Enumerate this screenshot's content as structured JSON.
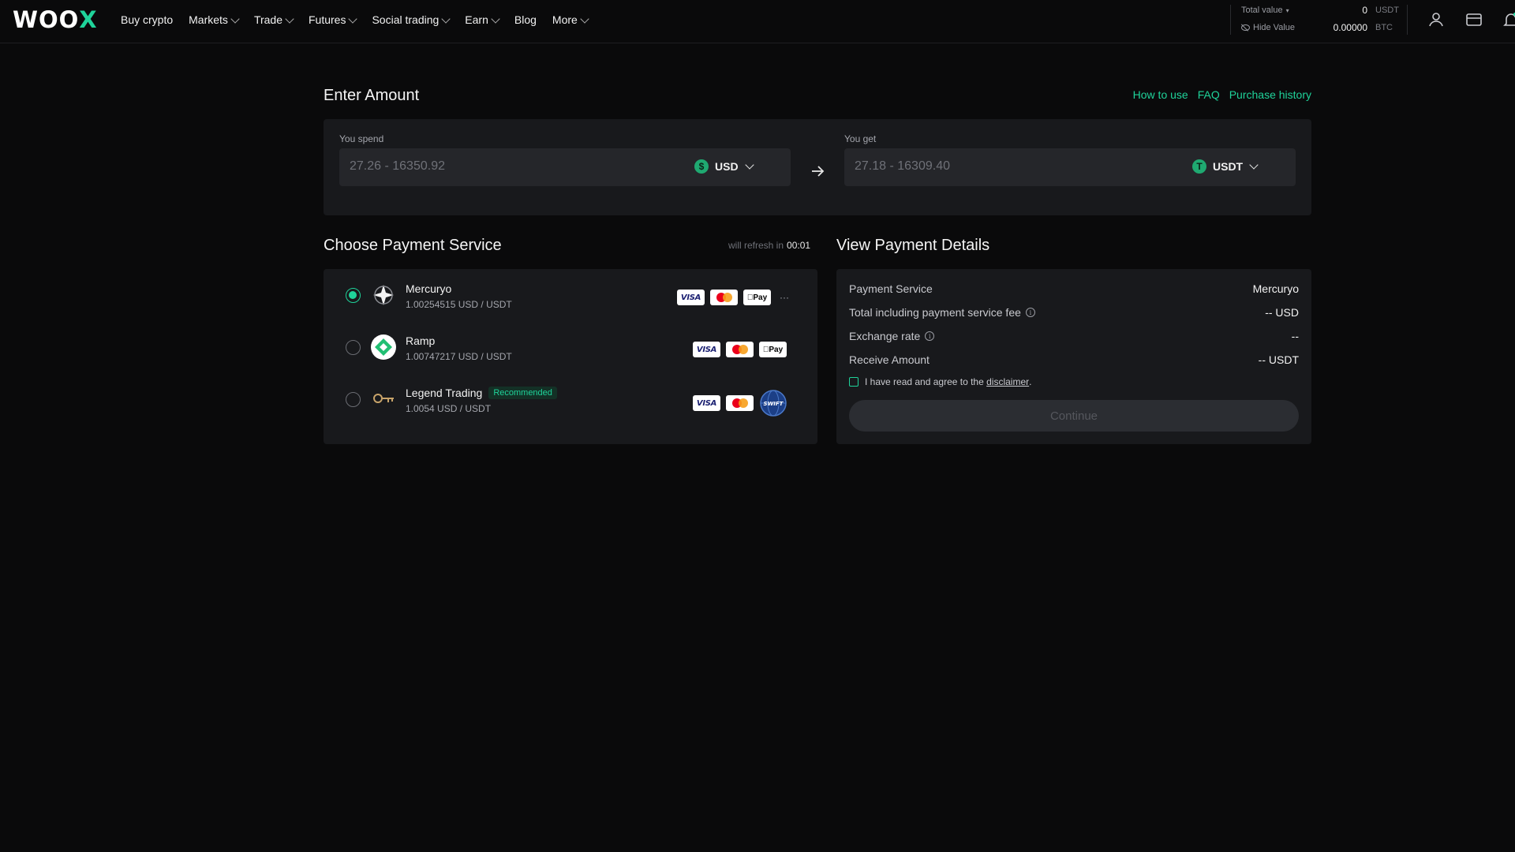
{
  "header": {
    "logo_text": "WOO",
    "logo_accent": "X",
    "nav": [
      {
        "label": "Buy crypto",
        "dropdown": false
      },
      {
        "label": "Markets",
        "dropdown": true
      },
      {
        "label": "Trade",
        "dropdown": true
      },
      {
        "label": "Futures",
        "dropdown": true
      },
      {
        "label": "Social trading",
        "dropdown": true
      },
      {
        "label": "Earn",
        "dropdown": true
      },
      {
        "label": "Blog",
        "dropdown": false
      },
      {
        "label": "More",
        "dropdown": true
      }
    ],
    "balance": {
      "total_label": "Total value",
      "total_value": "0",
      "total_unit": "USDT",
      "hide_label": "Hide Value",
      "btc_value": "0.00000",
      "btc_unit": "BTC"
    },
    "icons": [
      "user-icon",
      "wallet-icon",
      "bell-icon"
    ]
  },
  "page": {
    "title": "Enter Amount",
    "links": {
      "how_to_use": "How to use",
      "faq": "FAQ",
      "purchase_history": "Purchase history"
    }
  },
  "amount": {
    "spend_label": "You spend",
    "spend_placeholder": "27.26 - 16350.92",
    "spend_currency": "USD",
    "spend_coin_symbol": "$",
    "get_label": "You get",
    "get_placeholder": "27.18 - 16309.40",
    "get_currency": "USDT",
    "get_coin_symbol": "T"
  },
  "payment_service": {
    "title": "Choose Payment Service",
    "refresh_label": "will refresh in",
    "refresh_timer": "00:01",
    "providers": [
      {
        "name": "Mercuryo",
        "rate": "1.00254515 USD / USDT",
        "selected": true,
        "tag": "",
        "methods": [
          "visa",
          "mastercard",
          "applepay",
          "more"
        ]
      },
      {
        "name": "Ramp",
        "rate": "1.00747217 USD / USDT",
        "selected": false,
        "tag": "",
        "methods": [
          "visa",
          "mastercard",
          "applepay"
        ]
      },
      {
        "name": "Legend Trading",
        "rate": "1.0054 USD / USDT",
        "selected": false,
        "tag": "Recommended",
        "methods": [
          "visa",
          "mastercard",
          "swift"
        ]
      }
    ],
    "method_labels": {
      "visa": "VISA",
      "applepay": "Pay",
      "more": "···",
      "swift": "SWIFT"
    }
  },
  "details": {
    "title": "View Payment Details",
    "rows": [
      {
        "label": "Payment Service",
        "value": "Mercuryo",
        "info": false
      },
      {
        "label": "Total including payment service fee",
        "value": "-- USD",
        "info": true
      },
      {
        "label": "Exchange rate",
        "value": "--",
        "info": true
      },
      {
        "label": "Receive Amount",
        "value": "-- USDT",
        "info": false
      }
    ],
    "agree_text": "I have read and agree to the",
    "disclaimer_link": "disclaimer",
    "agree_suffix": ".",
    "continue_label": "Continue"
  },
  "colors": {
    "accent": "#1fd39a",
    "background": "#0a0a0b",
    "card": "#18191c",
    "input": "#25262a"
  }
}
